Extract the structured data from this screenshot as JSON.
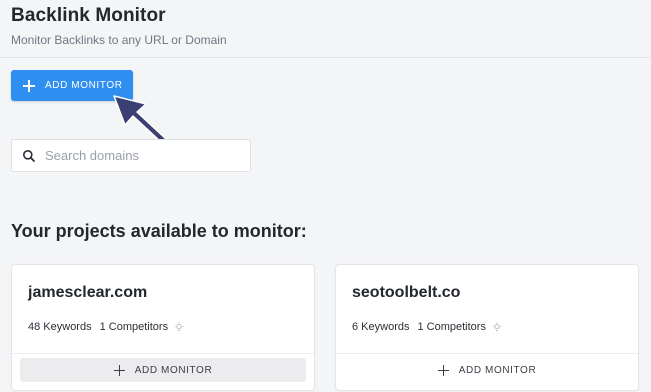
{
  "header": {
    "title": "Backlink Monitor",
    "subtitle": "Monitor Backlinks to any URL or Domain"
  },
  "toolbar": {
    "add_monitor_label": "ADD MONITOR"
  },
  "search": {
    "placeholder": "Search domains",
    "value": ""
  },
  "projects_section": {
    "title": "Your projects available to monitor:",
    "projects": [
      {
        "domain": "jamesclear.com",
        "keywords": "48 Keywords",
        "competitors": "1 Competitors",
        "add_label": "ADD MONITOR"
      },
      {
        "domain": "seotoolbelt.co",
        "keywords": "6 Keywords",
        "competitors": "1 Competitors",
        "add_label": "ADD MONITOR"
      }
    ]
  },
  "icons": {
    "plus": "plus-icon",
    "search": "search-icon",
    "bulb": "lightbulb-icon",
    "pointer": "pointer-arrow"
  },
  "colors": {
    "primary_button": "#2f8ff0",
    "annotation_arrow": "#3b3f72",
    "background": "#f4f5f7"
  }
}
